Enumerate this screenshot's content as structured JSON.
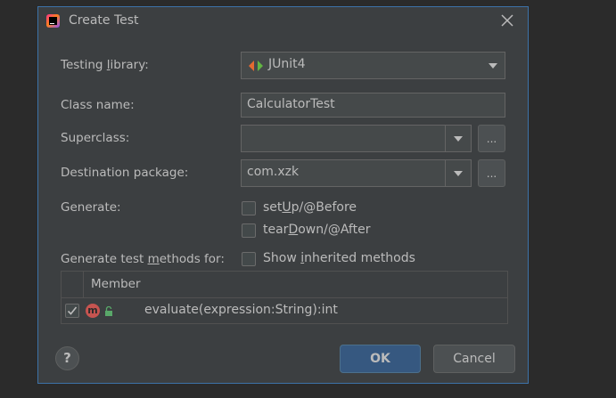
{
  "dialog": {
    "title": "Create Test"
  },
  "form": {
    "testing_library": {
      "label_pre": "Testing ",
      "label_underlined": "l",
      "label_post": "ibrary:",
      "value": "JUnit4"
    },
    "class_name": {
      "label": "Class name:",
      "value": "CalculatorTest"
    },
    "superclass": {
      "label": "Superclass:",
      "value": "",
      "browse_label": "..."
    },
    "destination_package": {
      "label": "Destination package:",
      "value": "com.xzk",
      "browse_label": "..."
    },
    "generate": {
      "label": "Generate:",
      "options": [
        {
          "pre": "set",
          "underlined": "U",
          "post": "p/@Before",
          "checked": false
        },
        {
          "pre": "tear",
          "underlined": "D",
          "post": "own/@After",
          "checked": false
        }
      ]
    },
    "methods_for": {
      "label_pre": "Generate test ",
      "label_underlined": "m",
      "label_post": "ethods for:",
      "show_inherited": {
        "pre": "Show ",
        "underlined": "i",
        "post": "nherited methods",
        "checked": false
      }
    }
  },
  "table": {
    "header_member": "Member",
    "rows": [
      {
        "checked": true,
        "icon_letter": "m",
        "name": "evaluate(expression:String):int"
      }
    ]
  },
  "buttons": {
    "help": "?",
    "ok": "OK",
    "cancel": "Cancel"
  },
  "colors": {
    "dialog_bg": "#3c3f41",
    "accent_border": "#3d72a8",
    "primary_button": "#365880",
    "method_icon": "#c75450"
  }
}
